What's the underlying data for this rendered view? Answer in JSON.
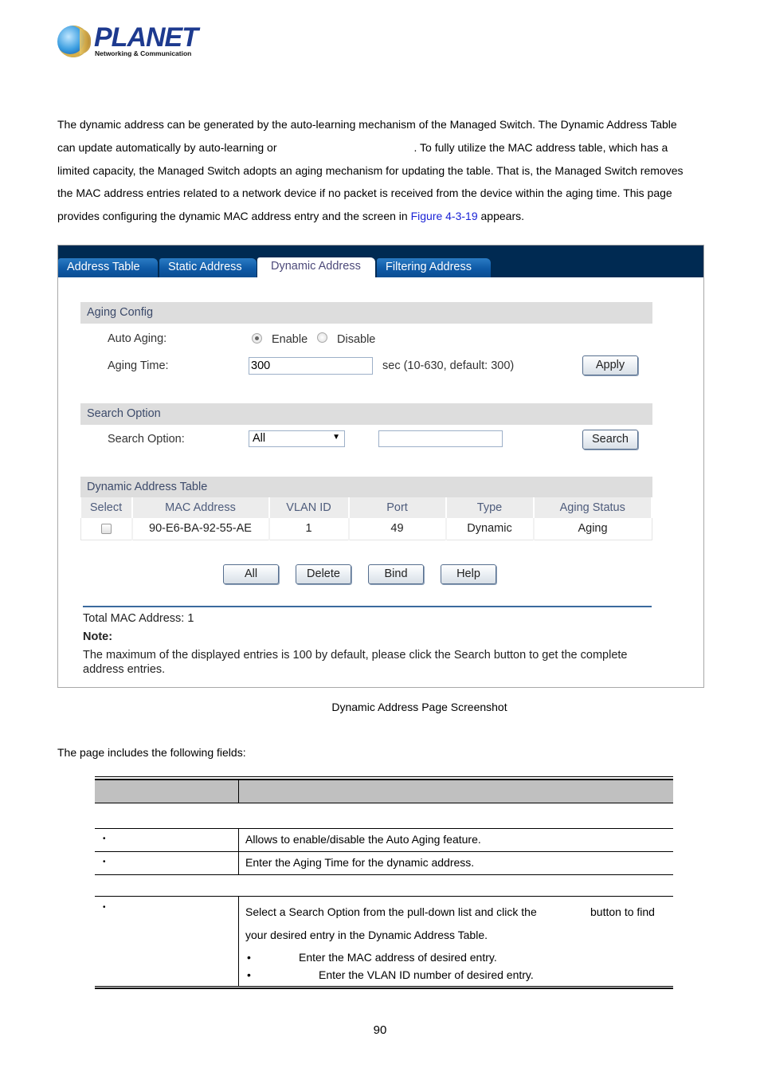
{
  "logo": {
    "brand": "PLANET",
    "tagline": "Networking & Communication"
  },
  "intro": {
    "line1": "The dynamic address can be generated by the auto-learning mechanism of the Managed Switch. The Dynamic Address Table",
    "line2a": "can update automatically by auto-learning or",
    "line2b": ". To fully utilize the MAC address table, which has a",
    "line3": "limited capacity, the Managed Switch adopts an aging mechanism for updating the table. That is, the Managed Switch removes",
    "line4": "the MAC address entries related to a network device if no packet is received from the device within the aging time. This page",
    "line5a": "provides configuring the dynamic MAC address entry and the screen in",
    "line5_link": "Figure 4-3-19",
    "line5b": "appears.",
    "link_color": "#1a22d6"
  },
  "screenshot": {
    "tabs": [
      {
        "label": "Address Table",
        "active": false
      },
      {
        "label": "Static Address",
        "active": false
      },
      {
        "label": "Dynamic Address",
        "active": true
      },
      {
        "label": "Filtering Address",
        "active": false
      }
    ],
    "aging_config": {
      "title": "Aging Config",
      "auto_aging_label": "Auto Aging:",
      "enable_label": "Enable",
      "disable_label": "Disable",
      "auto_aging_value": "Enable",
      "aging_time_label": "Aging Time:",
      "aging_time_value": "300",
      "aging_time_hint": "sec (10-630, default: 300)",
      "apply_label": "Apply"
    },
    "search_option": {
      "title": "Search Option",
      "label": "Search Option:",
      "selected": "All",
      "search_value": "",
      "search_label": "Search"
    },
    "address_table": {
      "title": "Dynamic Address Table",
      "columns": [
        "Select",
        "MAC Address",
        "VLAN ID",
        "Port",
        "Type",
        "Aging Status"
      ],
      "rows": [
        {
          "selected": false,
          "mac": "90-E6-BA-92-55-AE",
          "vlan": "1",
          "port": "49",
          "type": "Dynamic",
          "aging_status": "Aging"
        }
      ]
    },
    "buttons": {
      "all": "All",
      "delete": "Delete",
      "bind": "Bind",
      "help": "Help"
    },
    "total": "Total MAC Address: 1",
    "note_label": "Note:",
    "note_text": "The maximum of the displayed entries is 100 by default, please click the Search button to get the complete address entries.",
    "colors": {
      "topbar": "#002a52",
      "tab": "#0f5aa6",
      "section_header": "#dddddd",
      "divider": "#3a6a9e"
    }
  },
  "caption": "Dynamic Address Page Screenshot",
  "fields_intro": "The page includes the following fields:",
  "fields_table": {
    "rows": [
      {
        "desc": "Allows to enable/disable the Auto Aging feature."
      },
      {
        "desc": "Enter the Aging Time for the dynamic address."
      },
      {
        "desc_a": "Select a Search Option from the pull-down list and click the",
        "desc_b": "button to find",
        "desc_c": "your desired entry in the Dynamic Address Table.",
        "sub": [
          "Enter the MAC address of desired entry.",
          "Enter the VLAN ID number of desired entry."
        ]
      }
    ],
    "bullet": "•"
  },
  "page_number": "90"
}
